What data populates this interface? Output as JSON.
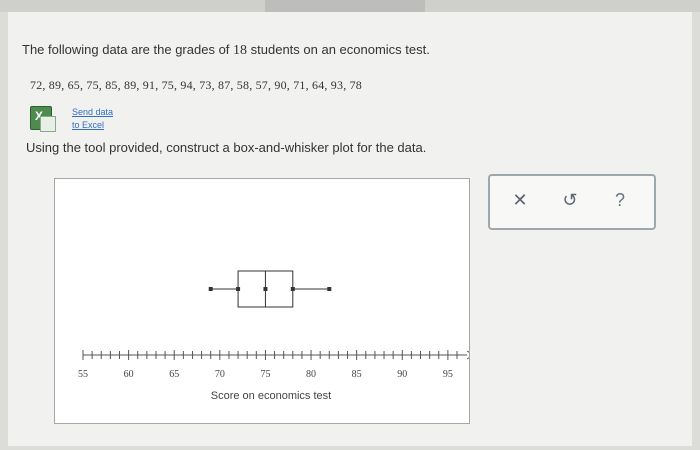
{
  "question": {
    "text_before": "The following data are the grades of ",
    "count": "18",
    "text_after": " students on an economics test."
  },
  "data_values": "72, 89, 65, 75, 85, 89, 91, 75, 94, 73, 87, 58, 57, 90, 71, 64, 93, 78",
  "send_link": {
    "line1": "Send data",
    "line2": "to Excel"
  },
  "instruction": "Using the tool provided, construct a box-and-whisker plot for the data.",
  "tools": {
    "close_symbol": "✕",
    "undo_symbol": "↺",
    "help_symbol": "?"
  },
  "chart_data": {
    "type": "boxplot",
    "xlabel": "Score on economics test",
    "x_range": [
      55,
      96
    ],
    "tick_labels": [
      "55",
      "60",
      "65",
      "70",
      "75",
      "80",
      "85",
      "90",
      "95"
    ],
    "box": {
      "min": 69,
      "q1": 72,
      "median": 75,
      "q3": 78,
      "max": 82
    }
  }
}
